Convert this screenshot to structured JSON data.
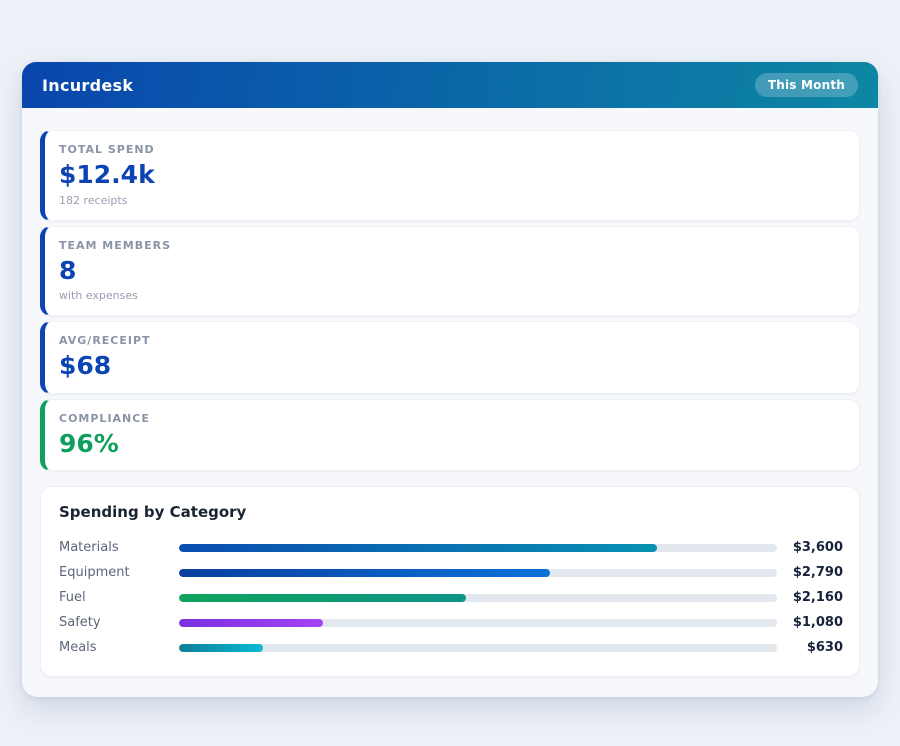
{
  "header": {
    "title": "Incurdesk",
    "badge": "This Month",
    "gradient_start": "#0946ad",
    "gradient_end": "#0d87a3"
  },
  "stats": [
    {
      "label": "TOTAL SPEND",
      "value": "$12.4k",
      "sub": "182 receipts",
      "accent": "#0d44b4",
      "value_color": "#0d44b4"
    },
    {
      "label": "TEAM MEMBERS",
      "value": "8",
      "sub": "with expenses",
      "accent": "#0d44b4",
      "value_color": "#0d44b4"
    },
    {
      "label": "AVG/RECEIPT",
      "value": "$68",
      "sub": "",
      "accent": "#0d44b4",
      "value_color": "#0d44b4"
    },
    {
      "label": "COMPLIANCE",
      "value": "96%",
      "sub": "",
      "accent": "#0f9f5c",
      "value_color": "#0f9f5c"
    }
  ],
  "chart_data": {
    "type": "bar",
    "orientation": "horizontal",
    "title": "Spending by Category",
    "categories": [
      "Materials",
      "Equipment",
      "Fuel",
      "Safety",
      "Meals"
    ],
    "values": [
      3600,
      2790,
      2160,
      1080,
      630
    ],
    "value_labels": [
      "$3,600",
      "$2,790",
      "$2,160",
      "$1,080",
      "$630"
    ],
    "scale_max": 4500,
    "track_color": "#e3e8ef",
    "bar_gradients": [
      [
        "#0a4cb0",
        "#0891b2"
      ],
      [
        "#0a3f9f",
        "#0b72d8"
      ],
      [
        "#0fa35c",
        "#0d9488"
      ],
      [
        "#7b2fe2",
        "#a344f2"
      ],
      [
        "#0e7e97",
        "#0cb9d6"
      ]
    ]
  }
}
